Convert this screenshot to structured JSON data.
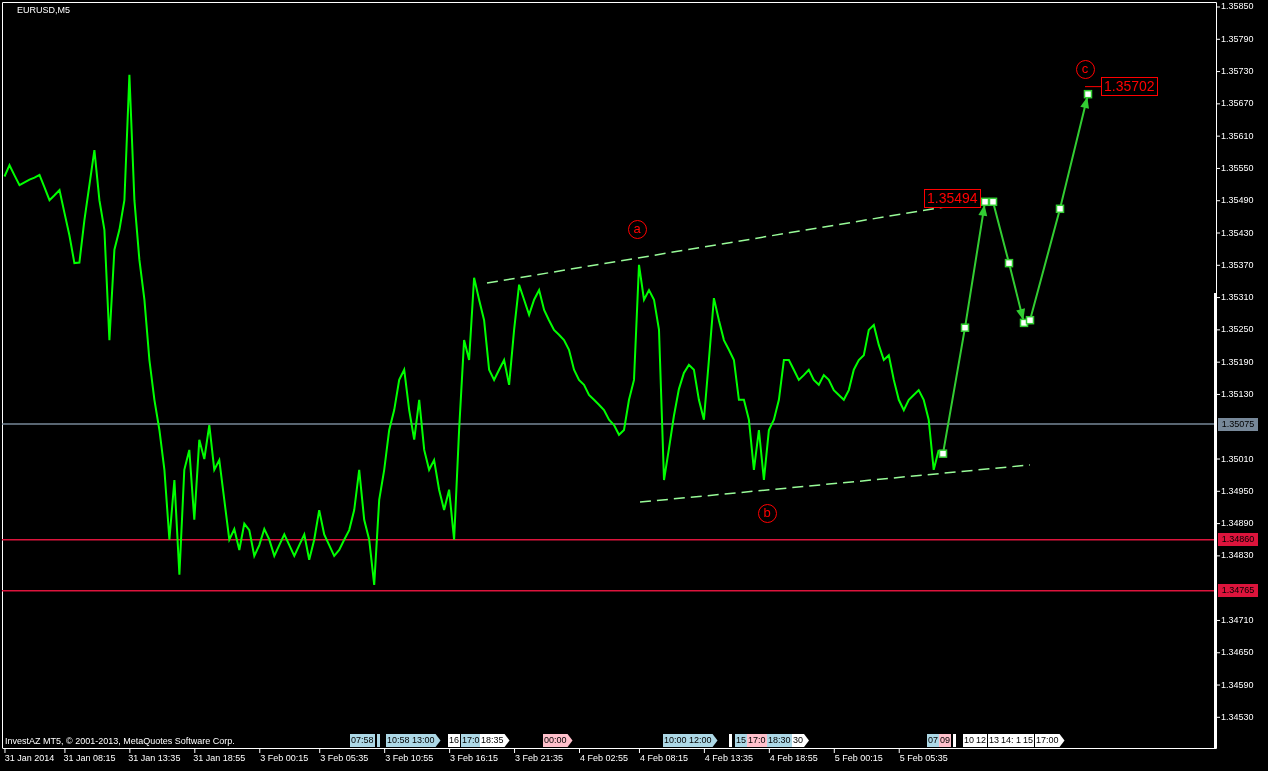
{
  "chart": {
    "chart_data": {
      "type": "line",
      "title": "EURUSD,M5",
      "ylim": [
        1.34473,
        1.35863
      ],
      "categories": [
        null,
        null,
        null,
        null,
        null,
        "31 Jan 2014",
        null,
        null,
        null,
        null,
        null,
        null,
        null,
        null,
        null,
        null,
        null,
        "31 Jan 08:15",
        null,
        null,
        null,
        null,
        null,
        null,
        null,
        null,
        null,
        null,
        null,
        null,
        "31 Jan 13:35",
        null,
        null,
        null,
        null,
        null,
        null,
        null,
        null,
        null,
        null,
        null,
        null,
        "31 Jan 18:55",
        null,
        null,
        null,
        null,
        null,
        null,
        null,
        null,
        null,
        null,
        null,
        null,
        "3 Feb 00:15",
        null,
        null,
        null,
        null,
        null,
        null,
        null,
        null,
        null,
        null,
        null,
        "3 Feb 05:35",
        null,
        null,
        null,
        null,
        null,
        null,
        null,
        null,
        null,
        null,
        null,
        null,
        "3 Feb 10:55",
        null,
        null,
        null,
        null,
        null,
        null,
        null,
        null,
        null,
        null,
        null,
        null,
        "3 Feb 16:15",
        null,
        null,
        null,
        null,
        null,
        null,
        null,
        null,
        null,
        null,
        null,
        null,
        "3 Feb 21:35",
        null,
        null,
        null,
        null,
        null,
        null,
        null,
        null,
        null,
        null,
        null,
        null,
        "4 Feb 02:55",
        null,
        null,
        null,
        null,
        null,
        null,
        null,
        null,
        null,
        null,
        null,
        "4 Feb 08:15",
        null,
        null,
        null,
        null,
        null,
        null,
        null,
        null,
        null,
        null,
        null,
        null,
        "4 Feb 13:35",
        null,
        null,
        null,
        null,
        null,
        null,
        null,
        null,
        null,
        null,
        null,
        null,
        "4 Feb 18:55",
        null,
        null,
        null,
        null,
        null,
        null,
        null,
        null,
        null,
        null,
        null,
        null,
        "5 Feb 00:15",
        null,
        null,
        null,
        null,
        null,
        null,
        null,
        null,
        null,
        null,
        null,
        null,
        "5 Feb 05:35",
        null,
        null,
        null,
        null,
        null,
        null,
        null,
        null,
        null,
        null,
        null,
        null,
        null,
        null,
        null,
        null,
        null,
        null,
        null,
        null,
        null,
        null,
        null,
        null,
        null,
        null,
        null,
        null,
        null,
        null,
        null,
        null,
        null,
        null,
        null,
        null,
        null,
        null,
        null,
        null,
        null,
        null,
        null,
        null,
        null,
        null,
        null,
        null,
        null,
        null,
        null,
        null,
        null,
        null,
        null,
        null,
        null,
        null
      ],
      "series": [
        {
          "color": "#00ff00",
          "values": [
            1.35535,
            1.35556,
            1.35537,
            1.35519,
            1.35524,
            1.35529,
            1.35533,
            1.35538,
            1.35515,
            1.35491,
            1.355,
            1.3551,
            1.35468,
            1.35426,
            1.35374,
            1.35375,
            1.35454,
            1.35519,
            1.35584,
            1.35491,
            1.35436,
            1.35231,
            1.35399,
            1.35436,
            1.35491,
            1.35724,
            1.35491,
            1.3538,
            1.35306,
            1.35194,
            1.3512,
            1.35064,
            1.3499,
            1.3486,
            1.34971,
            1.34795,
            1.3499,
            1.35027,
            1.34897,
            1.35046,
            1.3501,
            1.35073,
            1.3499,
            1.35008,
            1.34934,
            1.3486,
            1.3488,
            1.34841,
            1.3489,
            1.34878,
            1.3483,
            1.3485,
            1.3488,
            1.3486,
            1.3483,
            1.3485,
            1.3487,
            1.3485,
            1.3483,
            1.3485,
            1.3487,
            1.34823,
            1.3486,
            1.34915,
            1.3487,
            1.3485,
            1.3483,
            1.34841,
            1.3486,
            1.34878,
            1.34915,
            1.3499,
            1.34897,
            1.3486,
            1.34776,
            1.34934,
            1.3499,
            1.35064,
            1.35101,
            1.35157,
            1.35176,
            1.35101,
            1.35046,
            1.3512,
            1.35027,
            1.3499,
            1.35008,
            1.34953,
            1.34915,
            1.34953,
            1.3486,
            1.35064,
            1.35231,
            1.35194,
            1.35347,
            1.35306,
            1.35268,
            1.35176,
            1.35157,
            1.35176,
            1.35194,
            1.35148,
            1.3525,
            1.35334,
            1.35306,
            1.35278,
            1.35306,
            1.35324,
            1.35287,
            1.35268,
            1.3525,
            1.35241,
            1.35231,
            1.35213,
            1.35176,
            1.35157,
            1.35148,
            1.35129,
            1.3512,
            1.35111,
            1.35101,
            1.35083,
            1.35073,
            1.35055,
            1.35064,
            1.3512,
            1.35157,
            1.35371,
            1.35306,
            1.35324,
            1.35306,
            1.3525,
            1.34971,
            1.3503,
            1.3509,
            1.3514,
            1.3517,
            1.35185,
            1.35176,
            1.3512,
            1.35083,
            1.35194,
            1.35309,
            1.35268,
            1.35231,
            1.35213,
            1.35194,
            1.3512,
            1.3512,
            1.35083,
            1.3499,
            1.35064,
            1.34971,
            1.35064,
            1.35083,
            1.3512,
            1.35194,
            1.35194,
            1.35176,
            1.35157,
            1.35166,
            1.35176,
            1.35157,
            1.35148,
            1.35166,
            1.35157,
            1.35138,
            1.35129,
            1.3512,
            1.35138,
            1.35176,
            1.35194,
            1.35203,
            1.3525,
            1.35259,
            1.35222,
            1.35194,
            1.35203,
            1.35157,
            1.3512,
            1.35101,
            1.3512,
            1.35129,
            1.35138,
            1.3512,
            1.35083,
            1.3499,
            1.35027,
            null,
            null,
            null,
            null,
            null,
            null,
            null,
            null,
            null,
            null,
            null,
            null,
            null,
            null,
            null,
            null,
            null,
            null,
            null,
            null,
            null,
            null,
            null,
            null,
            null,
            null,
            null,
            null,
            null,
            null,
            null,
            null,
            null,
            null,
            null,
            null,
            null,
            null,
            null,
            null,
            null,
            null,
            null,
            null,
            null,
            null,
            null,
            null,
            null,
            null,
            null,
            null,
            null,
            null,
            null
          ]
        }
      ],
      "yticks": [
        {
          "value": 1.3585,
          "label": "1.35850"
        },
        {
          "value": 1.3579,
          "label": "1.35790"
        },
        {
          "value": 1.3573,
          "label": "1.35730"
        },
        {
          "value": 1.3567,
          "label": "1.35670"
        },
        {
          "value": 1.3561,
          "label": "1.35610"
        },
        {
          "value": 1.3555,
          "label": "1.35550"
        },
        {
          "value": 1.3549,
          "label": "1.35490"
        },
        {
          "value": 1.3543,
          "label": "1.35430"
        },
        {
          "value": 1.3537,
          "label": "1.35370"
        },
        {
          "value": 1.3531,
          "label": "1.35310"
        },
        {
          "value": 1.3525,
          "label": "1.35250"
        },
        {
          "value": 1.3519,
          "label": "1.35190"
        },
        {
          "value": 1.3513,
          "label": "1.35130"
        },
        {
          "value": 1.3501,
          "label": "1.35010"
        },
        {
          "value": 1.3495,
          "label": "1.34950"
        },
        {
          "value": 1.3489,
          "label": "1.34890"
        },
        {
          "value": 1.3483,
          "label": "1.34830"
        },
        {
          "value": 1.3471,
          "label": "1.34710"
        },
        {
          "value": 1.3465,
          "label": "1.34650"
        },
        {
          "value": 1.3459,
          "label": "1.34590"
        },
        {
          "value": 1.3453,
          "label": "1.34530"
        }
      ],
      "ref_lines": [
        {
          "axis": "y",
          "value": 1.35075,
          "label": "1.35075",
          "color": "#778899"
        },
        {
          "axis": "y",
          "value": 1.3486,
          "label": "1.34860",
          "color": "#dc143c"
        },
        {
          "axis": "y",
          "value": 1.34765,
          "label": "1.34765",
          "color": "#dc143c"
        }
      ],
      "annotations": [
        "a",
        "b",
        "c",
        "1.35494",
        "1.35702"
      ]
    },
    "event_tags": [
      {
        "text": "07:58",
        "color": "#add8e6",
        "pointed": false
      },
      {
        "color": "#add8e6",
        "pointed": false
      },
      {
        "text": "10:58",
        "color": "#add8e6",
        "pointed": false
      },
      {
        "text": "13:00",
        "color": "#add8e6",
        "pointed": true
      },
      {
        "text": "16",
        "color": "#ffffff",
        "pointed": false
      },
      {
        "text": "17:0",
        "color": "#add8e6",
        "pointed": false
      },
      {
        "text": "18:35",
        "color": "#ffffff",
        "pointed": true
      },
      {
        "text": "00:00",
        "color": "#ffc0cb",
        "pointed": true
      },
      {
        "text": "10:00",
        "color": "#add8e6",
        "pointed": false
      },
      {
        "text": "12:00",
        "color": "#add8e6",
        "pointed": true
      },
      {
        "color": "#ffffff",
        "pointed": false
      },
      {
        "text": "15",
        "color": "#add8e6",
        "pointed": false
      },
      {
        "text": "17:0",
        "color": "#ffc0cb",
        "pointed": false
      },
      {
        "text": "18:30",
        "color": "#add8e6",
        "pointed": false
      },
      {
        "text": "30",
        "color": "#ffffff",
        "pointed": true
      },
      {
        "text": "07",
        "color": "#add8e6",
        "pointed": false
      },
      {
        "text": "09",
        "color": "#ffc0cb",
        "pointed": false
      },
      {
        "color": "#ffffff",
        "pointed": false
      },
      {
        "text": "10",
        "color": "#ffffff",
        "pointed": false
      },
      {
        "text": "12",
        "color": "#ffffff",
        "pointed": false
      },
      {
        "text": "13",
        "color": "#ffffff",
        "pointed": false
      },
      {
        "text": "14:",
        "color": "#ffffff",
        "pointed": false
      },
      {
        "text": "1",
        "color": "#ffffff",
        "pointed": false
      },
      {
        "text": "15",
        "color": "#ffffff",
        "pointed": false
      },
      {
        "text": "17:00",
        "color": "#ffffff",
        "pointed": true
      }
    ],
    "copyright": "InvestAZ MT5, © 2001-2013, MetaQuotes Software Corp."
  }
}
